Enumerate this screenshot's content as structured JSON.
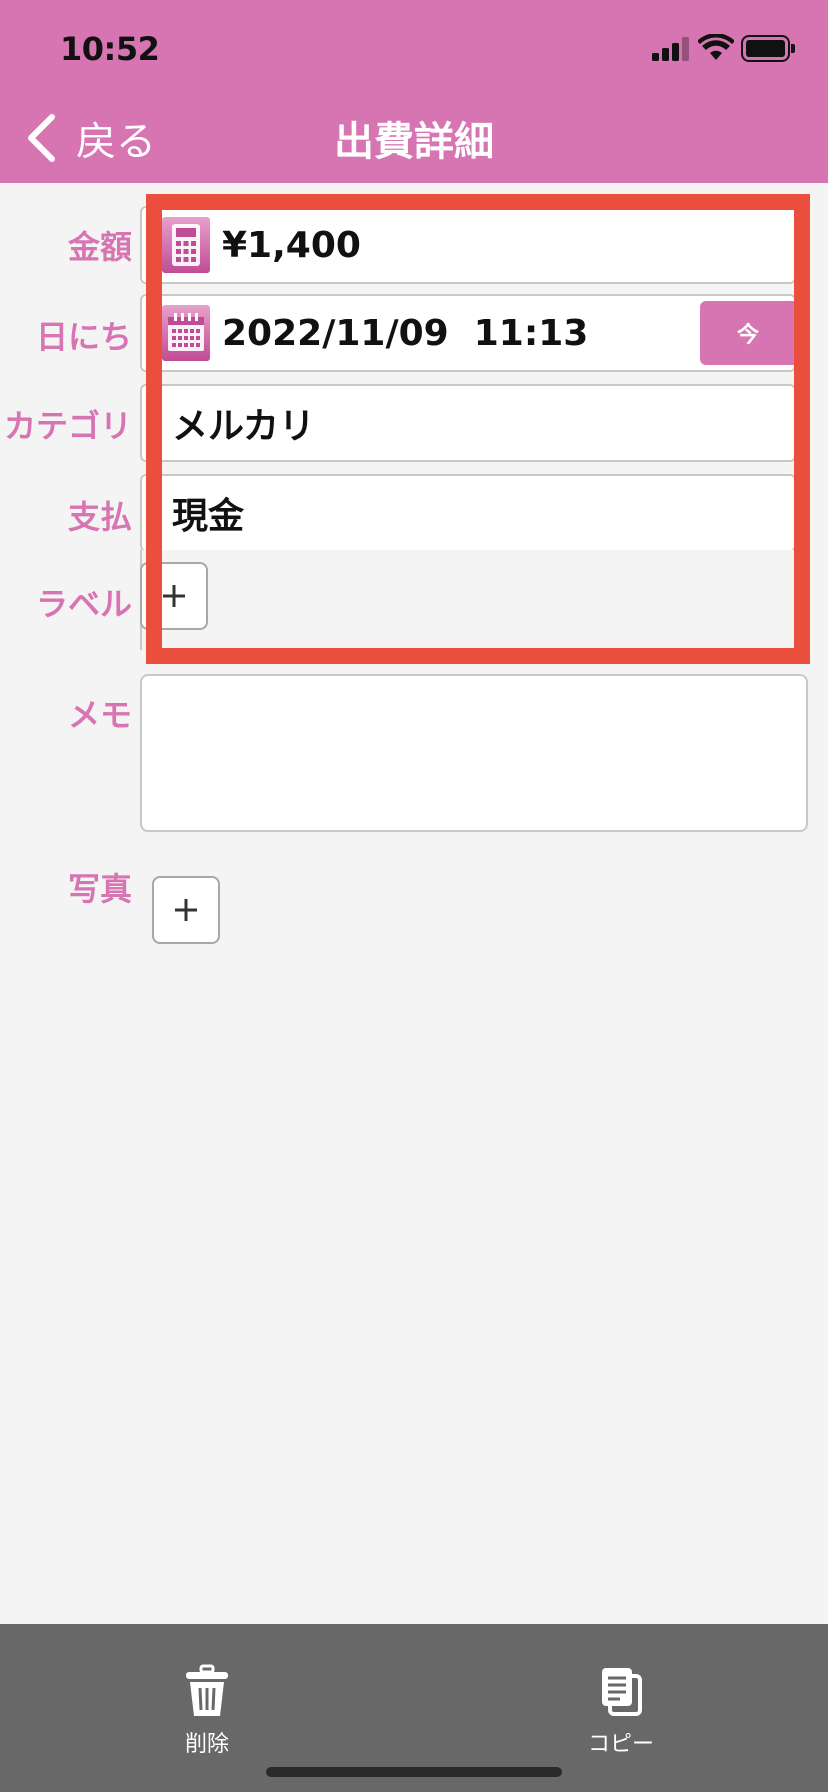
{
  "status_bar": {
    "time": "10:52"
  },
  "nav": {
    "back_label": "戻る",
    "title": "出費詳細"
  },
  "form": {
    "amount": {
      "label": "金額",
      "value": "¥1,400",
      "icon": "calculator-icon"
    },
    "date": {
      "label": "日にち",
      "value": "2022/11/09  11:13",
      "icon": "calendar-icon",
      "now_button": "今"
    },
    "category": {
      "label": "カテゴリ",
      "value": "メルカリ"
    },
    "payment": {
      "label": "支払",
      "value": "現金"
    },
    "tags": {
      "label": "ラベル"
    },
    "memo": {
      "label": "メモ",
      "value": ""
    },
    "photo": {
      "label": "写真"
    }
  },
  "toolbar": {
    "delete_label": "削除",
    "copy_label": "コピー"
  },
  "colors": {
    "accent": "#d775b3",
    "highlight": "#ea4e3d",
    "toolbar": "#686868",
    "background": "#f4f4f4"
  }
}
